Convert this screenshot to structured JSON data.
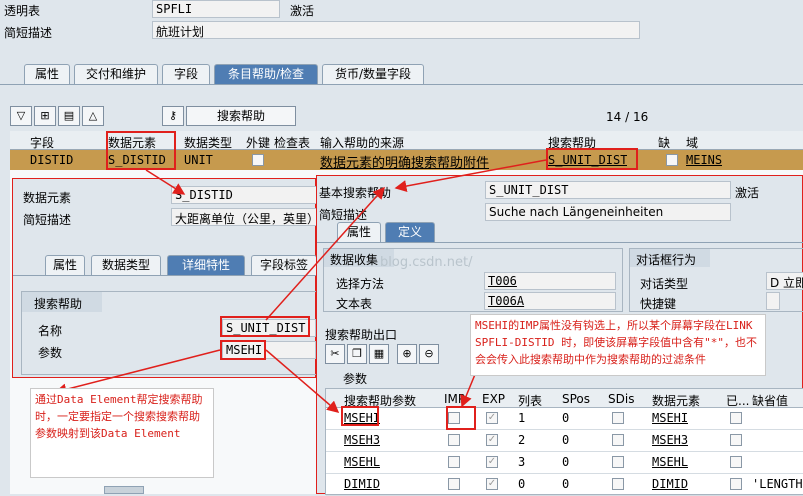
{
  "header": {
    "transparent_table_label": "透明表",
    "transparent_table_value": "SPFLI",
    "status_value": "激活",
    "short_desc_label": "简短描述",
    "short_desc_value": "航班计划"
  },
  "main_tabs": [
    {
      "label": "属性"
    },
    {
      "label": "交付和维护"
    },
    {
      "label": "字段"
    },
    {
      "label": "条目帮助/检查"
    },
    {
      "label": "货币/数量字段"
    }
  ],
  "toolbar": {
    "search_help_button": "搜索帮助",
    "page_counter": "14 / 16"
  },
  "table": {
    "headers": [
      "字段",
      "数据元素",
      "数据类型",
      "外键",
      "检查表",
      "输入帮助的来源",
      "搜索帮助",
      "缺",
      "域"
    ],
    "row": {
      "field": "DISTID",
      "data_element": "S_DISTID",
      "data_type": "UNIT",
      "source": "数据元素的明确搜索帮助附件",
      "search_help": "S_UNIT_DIST",
      "domain": "MEINS"
    }
  },
  "de_popup": {
    "data_element_label": "数据元素",
    "data_element_value": "S_DISTID",
    "short_desc_label": "简短描述",
    "short_desc_value": "大距离单位（公里，英里）",
    "tabs": [
      {
        "label": "属性"
      },
      {
        "label": "数据类型"
      },
      {
        "label": "详细特性"
      },
      {
        "label": "字段标签"
      }
    ],
    "group_title": "搜索帮助",
    "name_label": "名称",
    "name_value": "S_UNIT_DIST",
    "param_label": "参数",
    "param_value": "MSEHI"
  },
  "sh_popup": {
    "basic_sh_label": "基本搜索帮助",
    "basic_sh_value": "S_UNIT_DIST",
    "status_value": "激活",
    "short_desc_label": "简短描述",
    "short_desc_value": "Suche nach Längeneinheiten",
    "tabs": [
      {
        "label": "属性"
      },
      {
        "label": "定义"
      }
    ],
    "collect_title": "数据收集",
    "method_label": "选择方法",
    "method_value": "T006",
    "text_table_label": "文本表",
    "text_table_value": "T006A",
    "dialog_title": "对话框行为",
    "dialog_type_label": "对话类型",
    "dialog_type_value": "D 立即",
    "hotkey_label": "快捷键",
    "exit_label": "搜索帮助出口",
    "params_title": "参数",
    "param_headers": [
      "搜索帮助参数",
      "IMP",
      "EXP",
      "列表",
      "SPos",
      "SDis",
      "数据元素",
      "已...",
      "缺省值"
    ],
    "param_rows": [
      {
        "name": "MSEHI",
        "list": "1",
        "spos": "0",
        "de": "MSEHI",
        "default": ""
      },
      {
        "name": "MSEH3",
        "list": "2",
        "spos": "0",
        "de": "MSEH3",
        "default": ""
      },
      {
        "name": "MSEHL",
        "list": "3",
        "spos": "0",
        "de": "MSEHL",
        "default": ""
      },
      {
        "name": "DIMID",
        "list": "0",
        "spos": "0",
        "de": "DIMID",
        "default": "'LENGTH'"
      }
    ]
  },
  "notes": {
    "left": "通过Data Element帮定搜索帮助时，一定要指定一个搜索搜索帮助参数映射到该Data Element",
    "right": "MSEHI的IMP属性没有钩选上，所以某个屏幕字段在LINK SPFLI-DISTID 时，即使该屏幕字段值中含有\"*\"，也不会会传入此搜索帮助中作为搜索帮助的过滤条件"
  },
  "watermark": "blog.csdn.net/",
  "colors": {
    "tab_active": "#4f7db3",
    "row_highlight": "#c69a4e",
    "annotation_red": "#e0201c"
  }
}
